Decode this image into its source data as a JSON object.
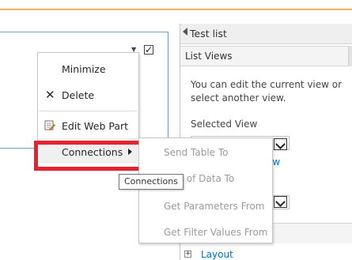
{
  "webpart": {
    "dropdown_arrow": "▼",
    "checkbox_mark": "✓"
  },
  "toolpane": {
    "title": "Test list",
    "section_title": "List Views",
    "description": "You can edit the current view or select another view.",
    "selected_view_label": "Selected View",
    "view_link_text": "ew",
    "layout_label": "Layout",
    "layout_expand_glyph": "+"
  },
  "context_menu": {
    "items": [
      {
        "label": "Minimize",
        "icon": null
      },
      {
        "label": "Delete",
        "icon": "delete-x-icon"
      },
      {
        "label": "Edit Web Part",
        "icon": "edit-webpart-icon"
      },
      {
        "label": "Connections",
        "icon": null,
        "has_submenu": true
      }
    ],
    "delete_glyph": "✕"
  },
  "submenu": {
    "items": [
      {
        "label": "Send Table To",
        "enabled": false
      },
      {
        "label": "Row of Data To",
        "enabled": false
      },
      {
        "label": "Get Parameters From",
        "enabled": false
      },
      {
        "label": "Get Filter Values From",
        "enabled": false
      }
    ]
  },
  "tooltip": {
    "text": "Connections"
  },
  "colors": {
    "accent_top_rule": "#f7b060",
    "link": "#0072c6",
    "highlight": "#e8212f",
    "disabled_text": "#9a9a9a"
  }
}
